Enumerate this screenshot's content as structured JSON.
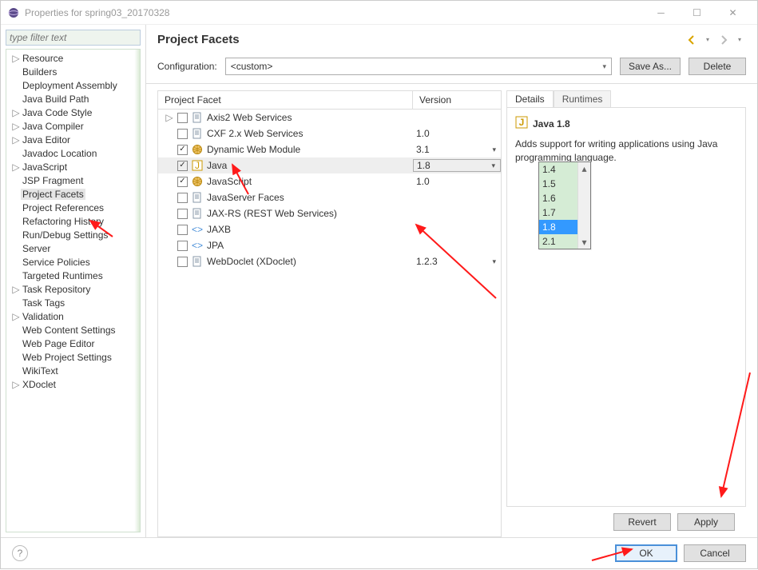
{
  "window": {
    "title": "Properties for spring03_20170328"
  },
  "filter": {
    "placeholder": "type filter text"
  },
  "tree": [
    {
      "label": "Resource",
      "expandable": true
    },
    {
      "label": "Builders"
    },
    {
      "label": "Deployment Assembly"
    },
    {
      "label": "Java Build Path"
    },
    {
      "label": "Java Code Style",
      "expandable": true
    },
    {
      "label": "Java Compiler",
      "expandable": true
    },
    {
      "label": "Java Editor",
      "expandable": true
    },
    {
      "label": "Javadoc Location"
    },
    {
      "label": "JavaScript",
      "expandable": true
    },
    {
      "label": "JSP Fragment"
    },
    {
      "label": "Project Facets",
      "selected": true
    },
    {
      "label": "Project References"
    },
    {
      "label": "Refactoring History"
    },
    {
      "label": "Run/Debug Settings"
    },
    {
      "label": "Server"
    },
    {
      "label": "Service Policies"
    },
    {
      "label": "Targeted Runtimes"
    },
    {
      "label": "Task Repository",
      "expandable": true
    },
    {
      "label": "Task Tags"
    },
    {
      "label": "Validation",
      "expandable": true
    },
    {
      "label": "Web Content Settings"
    },
    {
      "label": "Web Page Editor"
    },
    {
      "label": "Web Project Settings"
    },
    {
      "label": "WikiText"
    },
    {
      "label": "XDoclet",
      "expandable": true
    }
  ],
  "page": {
    "title": "Project Facets",
    "config_label": "Configuration:",
    "config_value": "<custom>",
    "save_as": "Save As...",
    "delete": "Delete",
    "col_facet": "Project Facet",
    "col_version": "Version"
  },
  "facets": [
    {
      "label": "Axis2 Web Services",
      "checked": false,
      "version": "",
      "expandable": true,
      "icon": "doc"
    },
    {
      "label": "CXF 2.x Web Services",
      "checked": false,
      "version": "1.0",
      "icon": "doc"
    },
    {
      "label": "Dynamic Web Module",
      "checked": true,
      "version": "3.1",
      "dd": true,
      "icon": "globe"
    },
    {
      "label": "Java",
      "checked": true,
      "version": "1.8",
      "dd": true,
      "selected": true,
      "icon": "java"
    },
    {
      "label": "JavaScript",
      "checked": true,
      "version": "1.0",
      "icon": "globe"
    },
    {
      "label": "JavaServer Faces",
      "checked": false,
      "version": "",
      "icon": "doc"
    },
    {
      "label": "JAX-RS (REST Web Services)",
      "checked": false,
      "version": "",
      "icon": "doc"
    },
    {
      "label": "JAXB",
      "checked": false,
      "version": "",
      "icon": "xml"
    },
    {
      "label": "JPA",
      "checked": false,
      "version": "",
      "icon": "xml"
    },
    {
      "label": "WebDoclet (XDoclet)",
      "checked": false,
      "version": "1.2.3",
      "dd": true,
      "icon": "doc"
    }
  ],
  "dropdown": {
    "options": [
      "1.4",
      "1.5",
      "1.6",
      "1.7",
      "1.8",
      "2.1"
    ],
    "highlight": "1.8"
  },
  "details": {
    "tab_details": "Details",
    "tab_runtimes": "Runtimes",
    "title": "Java 1.8",
    "desc": "Adds support for writing applications using Java programming language."
  },
  "buttons": {
    "revert": "Revert",
    "apply": "Apply",
    "ok": "OK",
    "cancel": "Cancel"
  }
}
